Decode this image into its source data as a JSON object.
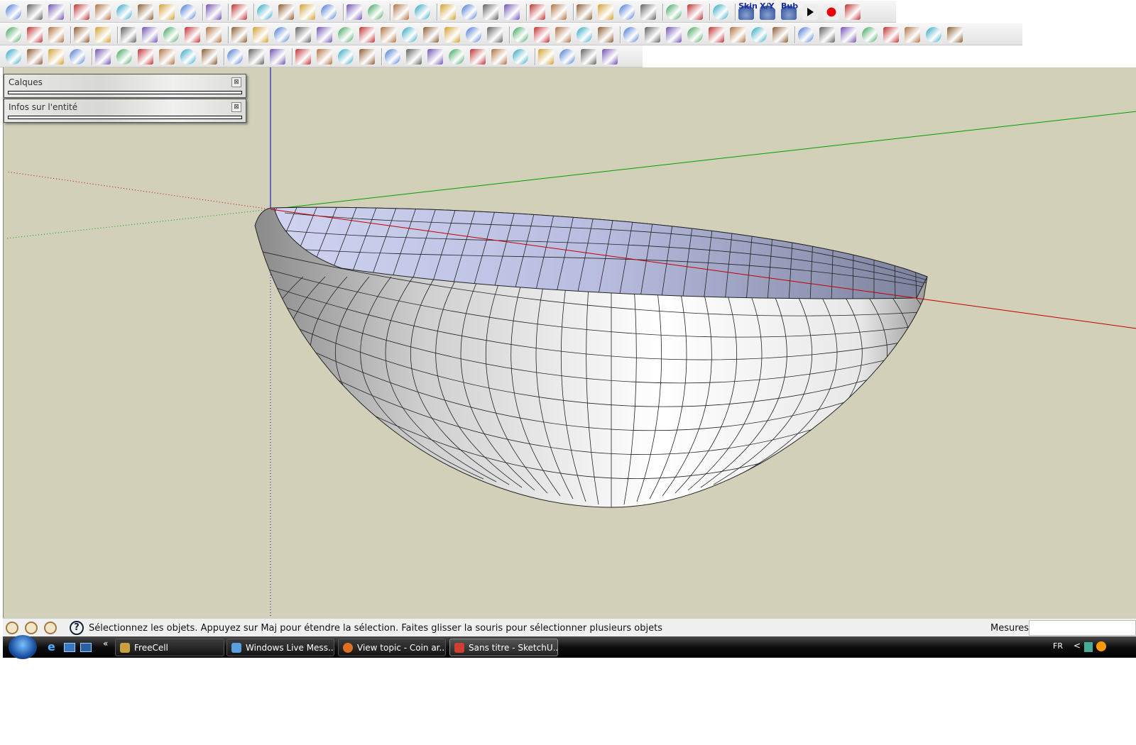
{
  "toolbar": {
    "row1": [
      "new",
      "open",
      "save",
      "|",
      "cut",
      "copy",
      "paste",
      "erase",
      "undo",
      "redo",
      "|",
      "print",
      "|",
      "model-info",
      "|",
      "component",
      "paint",
      "line-dots",
      "arc-dots",
      "|",
      "warning",
      "star",
      "|",
      "sandbox-a",
      "sandbox-b",
      "|",
      "select-a",
      "select-b",
      "push",
      "flag",
      "|",
      "orbit-loop",
      "cube",
      "|",
      "grid-a",
      "grid-b",
      "grid-c",
      "grid-d",
      "|",
      "tree",
      "tree-b",
      "|",
      "box",
      "|",
      "skin",
      "xy",
      "bub",
      "play",
      "stop",
      "help"
    ],
    "row2": [
      "font-fx",
      "cube-color",
      "bar",
      "|",
      "arrows-up",
      "arrows-down",
      "|",
      "scale",
      "mirror",
      "rotate-a",
      "rotate-b",
      "doc",
      "|",
      "curve-a",
      "curve-b",
      "curve-c",
      "curve-d",
      "curve-e",
      "arc-green",
      "rect",
      "spiral",
      "arc-b",
      "zigzag",
      "arc-c",
      "arc-d",
      "arc-red",
      "|",
      "polyline",
      "polygon",
      "wrench",
      "circle",
      "cone-outline",
      "|",
      "close-x",
      "hatch",
      "diamond",
      "blob",
      "hook",
      "hook-b",
      "spring",
      "flag-green",
      "|",
      "pyramid",
      "cone",
      "sphere",
      "cube-brown",
      "torus",
      "bean",
      "dome",
      "drop"
    ],
    "row3": [
      "record",
      "loop",
      "prev",
      "rewind",
      "|",
      "box-solid",
      "octagon",
      "cylinder",
      "cone-solid",
      "cylinder-b",
      "plate",
      "|",
      "donut",
      "shapes",
      "upload",
      "|",
      "film-play",
      "film-rewind",
      "ui",
      "puzzle",
      "|",
      "rotate-purple",
      "pencil-red",
      "dashed-circle",
      "pencil-green",
      "refresh",
      "pin",
      "ball",
      "|",
      "gem",
      "spring-cyan",
      "dropper",
      "cross-red"
    ],
    "skin_label": "Skin",
    "xy_label": "X/Y",
    "bub_label": "Bub"
  },
  "panels": [
    {
      "title": "Calques",
      "close": "⊠"
    },
    {
      "title": "Infos sur l'entité",
      "close": "⊠"
    }
  ],
  "status": {
    "message": "Sélectionnez les objets. Appuyez sur Maj pour étendre la sélection. Faites glisser la souris pour sélectionner plusieurs objets",
    "measures_label": "Mesures",
    "measures_value": ""
  },
  "taskbar": {
    "tasks": [
      {
        "label": "FreeCell",
        "color": "#c8a040"
      },
      {
        "label": "Windows Live Mess...",
        "color": "#5aa0e0"
      },
      {
        "label": "View topic - Coin ar...",
        "color": "#e07020"
      },
      {
        "label": "Sans titre - SketchU...",
        "color": "#d04030"
      }
    ],
    "lang": "FR",
    "chevron": "«",
    "tray": "<"
  },
  "colors": {
    "viewport_bg": "#d2d0b8",
    "axis_red": "#c00000",
    "axis_green": "#00a000",
    "axis_blue": "#0000c0",
    "bowl_inner": "#c4c9ea"
  }
}
